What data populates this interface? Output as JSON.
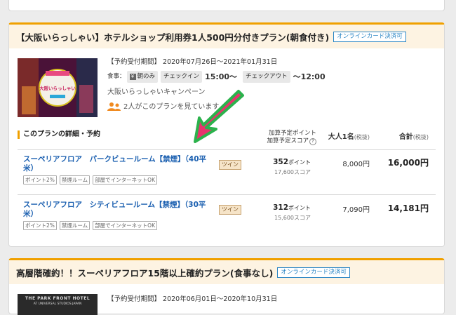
{
  "plan1": {
    "title": "【大阪いらっしゃい】ホテルショップ利用券1人500円分付きプラン(朝食付き)",
    "badge": "オンラインカード決済可",
    "period": "【予約受付期間】 2020年07月26日～2021年01月31日",
    "meal_label": "食事：",
    "meal_value": "朝のみ",
    "checkin_label": "チェックイン",
    "checkin_time": "15:00～",
    "checkout_label": "チェックアウト",
    "checkout_time": "～12:00",
    "campaign": "大阪いらっしゃいキャンペーン",
    "viewers": "2人がこのプランを見ています",
    "section_title": "このプランの詳細・予約",
    "col_points_1": "加算予定ポイント",
    "col_points_2": "加算予定スコア",
    "col_adult": "大人1名",
    "col_adult_note": "(税抜)",
    "col_total": "合計",
    "col_total_note": "(税抜)",
    "rooms": [
      {
        "name": "スーペリアフロア　パークビュールーム【禁煙】（40平米）",
        "type": "ツイン",
        "tags": [
          "ポイント2%",
          "禁煙ルーム",
          "部屋でインターネットOK"
        ],
        "points": "352",
        "points_unit": "ポイント",
        "score": "17,600スコア",
        "adult": "8,000円",
        "total": "16,000円"
      },
      {
        "name": "スーペリアフロア　シティビュールーム【禁煙】（30平米）",
        "type": "ツイン",
        "tags": [
          "ポイント2%",
          "禁煙ルーム",
          "部屋でインターネットOK"
        ],
        "points": "312",
        "points_unit": "ポイント",
        "score": "15,600スコア",
        "adult": "7,090円",
        "total": "14,181円"
      }
    ]
  },
  "plan2": {
    "title": "高層階確約！！スーペリアフロア15階以上確約プラン(食事なし)",
    "badge": "オンラインカード決済可",
    "period": "【予約受付期間】 2020年06月01日～2020年10月31日",
    "thumb_text_1": "THE PARK FRONT HOTEL",
    "thumb_text_2": "AT UNIVERSAL STUDIOS JAPAN"
  },
  "thumb1_text": "大阪いらっしゃい",
  "colors": {
    "accent": "#f0a000",
    "link": "#1a5fb0",
    "arrow": "#e8336d",
    "arrow_outline": "#2bb24c"
  }
}
